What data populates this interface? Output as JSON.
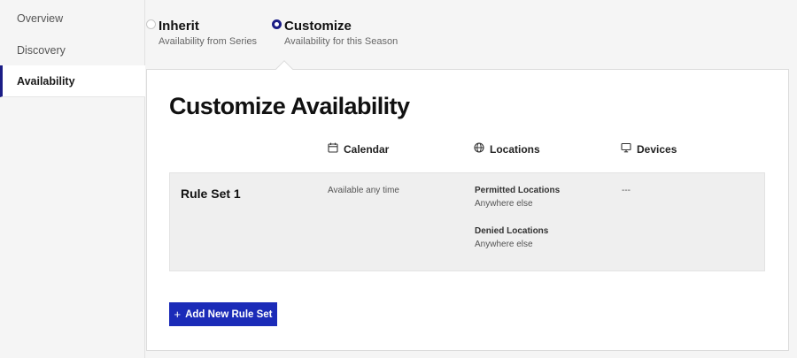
{
  "sidebar": {
    "items": [
      {
        "label": "Overview"
      },
      {
        "label": "Discovery"
      },
      {
        "label": "Availability"
      }
    ]
  },
  "mode": {
    "options": [
      {
        "title": "Inherit",
        "subtitle": "Availability from Series",
        "selected": false
      },
      {
        "title": "Customize",
        "subtitle": "Availability for this Season",
        "selected": true
      }
    ]
  },
  "panel": {
    "title": "Customize Availability",
    "columns": [
      {
        "label": "Calendar",
        "icon": "calendar-icon"
      },
      {
        "label": "Locations",
        "icon": "globe-icon"
      },
      {
        "label": "Devices",
        "icon": "monitor-icon"
      }
    ],
    "rule_sets": [
      {
        "name": "Rule Set 1",
        "calendar": "Available any time",
        "permitted_label": "Permitted Locations",
        "permitted_value": "Anywhere else",
        "denied_label": "Denied Locations",
        "denied_value": "Anywhere else",
        "devices": "---"
      }
    ],
    "add_button_label": "Add New Rule Set",
    "add_button_icon": "plus-icon"
  },
  "colors": {
    "accent": "#1b1d86",
    "button": "#1b2bb8"
  }
}
